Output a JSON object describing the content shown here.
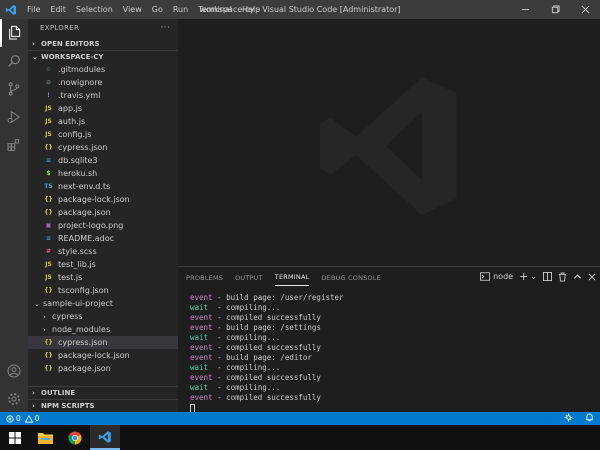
{
  "window": {
    "title": "workspace-cy - Visual Studio Code [Administrator]",
    "menu": [
      "File",
      "Edit",
      "Selection",
      "View",
      "Go",
      "Run",
      "Terminal",
      "Help"
    ]
  },
  "sidebar": {
    "title": "EXPLORER",
    "more": "···",
    "open_editors": "OPEN EDITORS",
    "workspace": "WORKSPACE-CY",
    "files": [
      {
        "icon": "⚙",
        "name": ".gitmodules"
      },
      {
        "icon": "⊘",
        "name": ".nowignore"
      },
      {
        "icon": "!",
        "name": ".travis.yml"
      },
      {
        "icon": "JS",
        "name": "app.js"
      },
      {
        "icon": "JS",
        "name": "auth.js"
      },
      {
        "icon": "JS",
        "name": "config.js"
      },
      {
        "icon": "{}",
        "name": "cypress.json"
      },
      {
        "icon": "≡",
        "name": "db.sqlite3"
      },
      {
        "icon": "$",
        "name": "heroku.sh"
      },
      {
        "icon": "TS",
        "name": "next-env.d.ts"
      },
      {
        "icon": "{}",
        "name": "package-lock.json"
      },
      {
        "icon": "{}",
        "name": "package.json"
      },
      {
        "icon": "▣",
        "name": "project-logo.png"
      },
      {
        "icon": "≡",
        "name": "README.adoc"
      },
      {
        "icon": "#",
        "name": "style.scss"
      },
      {
        "icon": "JS",
        "name": "test_lib.js"
      },
      {
        "icon": "JS",
        "name": "test.js"
      },
      {
        "icon": "{}",
        "name": "tsconfig.json"
      }
    ],
    "subfolder": "sample-ui-project",
    "subfolder_items": [
      {
        "type": "folder",
        "name": "cypress"
      },
      {
        "type": "folder",
        "name": "node_modules"
      },
      {
        "type": "file",
        "icon": "{}",
        "name": "cypress.json"
      },
      {
        "type": "file",
        "icon": "{}",
        "name": "package-lock.json"
      },
      {
        "type": "file",
        "icon": "{}",
        "name": "package.json"
      }
    ],
    "outline": "OUTLINE",
    "npm_scripts": "NPM SCRIPTS"
  },
  "panel": {
    "tabs": [
      "PROBLEMS",
      "OUTPUT",
      "TERMINAL",
      "DEBUG CONSOLE"
    ],
    "active_tab": "TERMINAL",
    "terminal_select": "node",
    "terminal_lines": [
      {
        "kw": "event",
        "text": " - build page: /user/register"
      },
      {
        "kw": "wait",
        "text": "  - compiling..."
      },
      {
        "kw": "event",
        "text": " - compiled successfully"
      },
      {
        "kw": "event",
        "text": " - build page: /settings"
      },
      {
        "kw": "wait",
        "text": "  - compiling..."
      },
      {
        "kw": "event",
        "text": " - compiled successfully"
      },
      {
        "kw": "event",
        "text": " - build page: /editor"
      },
      {
        "kw": "wait",
        "text": "  - compiling..."
      },
      {
        "kw": "event",
        "text": " - compiled successfully"
      },
      {
        "kw": "wait",
        "text": "  - compiling..."
      },
      {
        "kw": "event",
        "text": " - compiled successfully"
      }
    ]
  },
  "statusbar": {
    "errors": "0",
    "warnings": "0"
  },
  "colors": {
    "accent": "#007acc",
    "event_keyword": "#c586c0",
    "wait_keyword": "#4ec9b0"
  }
}
